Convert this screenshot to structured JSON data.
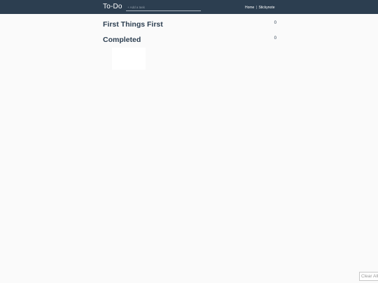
{
  "header": {
    "title": "To-Do",
    "add_placeholder": "+ Add a task",
    "nav": {
      "home_label": "Home",
      "separator": "|",
      "stickynote_label": "Stickynote"
    }
  },
  "sections": {
    "first": {
      "title": "First Things First",
      "count": "0"
    },
    "completed": {
      "title": "Completed",
      "count": "0"
    }
  },
  "footer": {
    "clear_label": "Clear All"
  },
  "colors": {
    "header_bg": "#2c3e50",
    "accent_text": "#2c3e50",
    "page_bg": "#fafafa"
  }
}
